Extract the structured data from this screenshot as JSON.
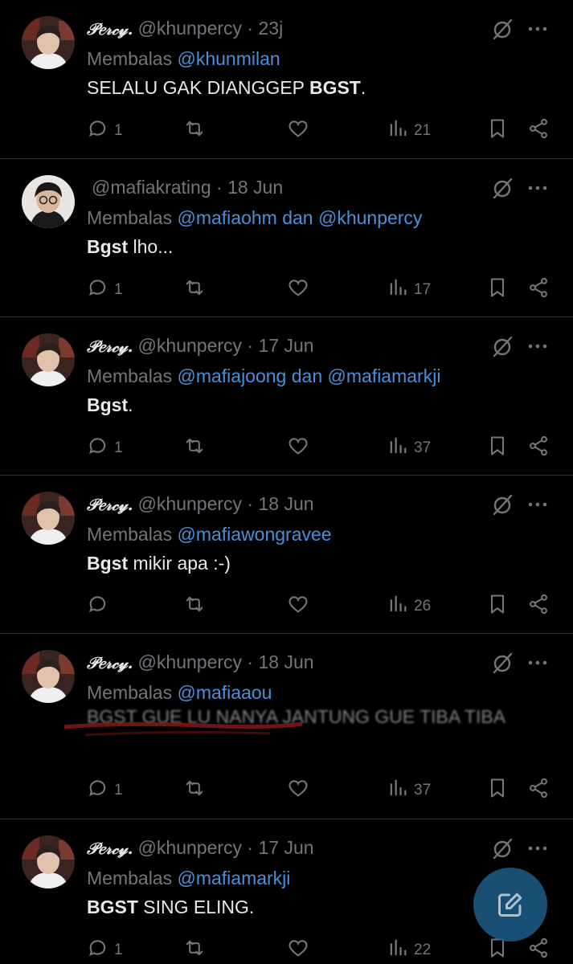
{
  "tweets": [
    {
      "name": "𝒫𝑒𝓇𝒸𝓎.",
      "meta": "@khunpercy · 23j",
      "reply_prefix": "Membalas ",
      "reply_to": "@khunmilan",
      "text_bold": "",
      "text_plain": "SELALU GAK DIANGGEP ",
      "text_bold2": "BGST",
      "text_tail": ".",
      "replies": "1",
      "views": "21",
      "avatar": "percy"
    },
    {
      "name": "",
      "meta": "@mafiakrating · 18 Jun",
      "reply_prefix": "Membalas ",
      "reply_to": "@mafiaohm dan @khunpercy",
      "text_bold": "Bgst",
      "text_plain": " lho...",
      "text_bold2": "",
      "text_tail": "",
      "replies": "1",
      "views": "17",
      "avatar": "krating"
    },
    {
      "name": "𝒫𝑒𝓇𝒸𝓎.",
      "meta": "@khunpercy · 17 Jun",
      "reply_prefix": "Membalas ",
      "reply_to": "@mafiajoong dan @mafiamarkji",
      "text_bold": "Bgst",
      "text_plain": ".",
      "text_bold2": "",
      "text_tail": "",
      "replies": "1",
      "views": "37",
      "avatar": "percy"
    },
    {
      "name": "𝒫𝑒𝓇𝒸𝓎.",
      "meta": "@khunpercy · 18 Jun",
      "reply_prefix": "Membalas ",
      "reply_to": "@mafiawongravee",
      "text_bold": "Bgst",
      "text_plain": " mikir apa :-)",
      "text_bold2": "",
      "text_tail": "",
      "replies": "",
      "views": "26",
      "avatar": "percy"
    },
    {
      "name": "𝒫𝑒𝓇𝒸𝓎.",
      "meta": "@khunpercy · 18 Jun",
      "reply_prefix": "Membalas ",
      "reply_to": "@mafiaaou",
      "text_bold": "",
      "text_plain": "BGST GUE LU NANYA JANTUNG GUE TIBA TIBA",
      "text_bold2": "",
      "text_tail": "",
      "replies": "1",
      "views": "37",
      "avatar": "percy"
    },
    {
      "name": "𝒫𝑒𝓇𝒸𝓎.",
      "meta": "@khunpercy · 17 Jun",
      "reply_prefix": "Membalas ",
      "reply_to": "@mafiamarkji",
      "text_bold": "BGST",
      "text_plain": " SING ELING.",
      "text_bold2": "",
      "text_tail": "",
      "replies": "1",
      "views": "22",
      "avatar": "percy"
    }
  ],
  "colors": {
    "bg": "#000000",
    "text": "#e7e9ea",
    "muted": "#71767b",
    "link": "#4a90d9",
    "divider": "#2f3336",
    "fab": "#1d5d88"
  }
}
